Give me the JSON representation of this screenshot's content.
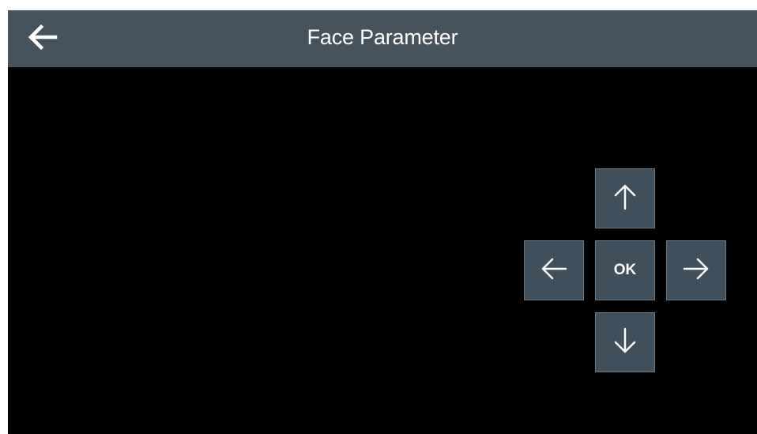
{
  "header": {
    "title": "Face Parameter",
    "back_icon": "arrow-left-icon"
  },
  "dpad": {
    "up_icon": "arrow-up-icon",
    "down_icon": "arrow-down-icon",
    "left_icon": "arrow-left-icon",
    "right_icon": "arrow-right-icon",
    "ok_label": "OK"
  },
  "colors": {
    "header_bg": "#46525c",
    "screen_bg": "#000000",
    "button_bg": "#3f4f5b",
    "button_border": "#6a7884",
    "text": "#ffffff"
  }
}
